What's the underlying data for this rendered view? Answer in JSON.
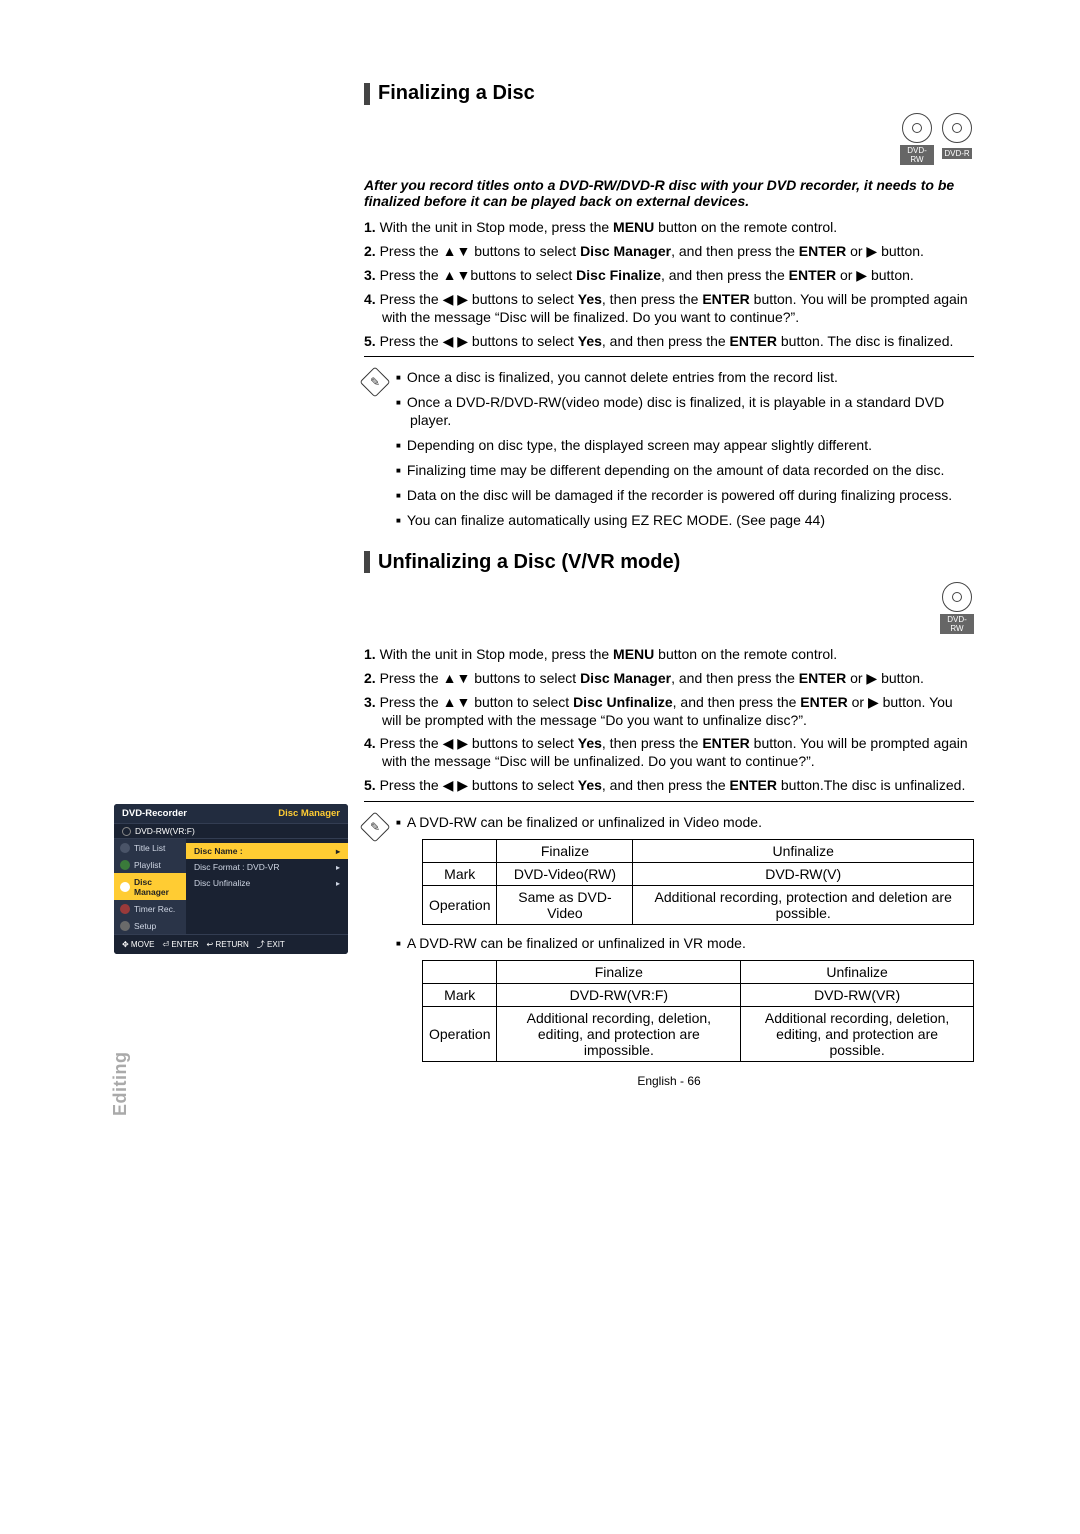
{
  "sidebar_label": "Editing",
  "sections": {
    "finalize": {
      "title": "Finalizing a Disc",
      "disc_icons": [
        "DVD-RW",
        "DVD-R"
      ],
      "intro": "After you record titles onto a DVD-RW/DVD-R disc with your DVD recorder, it needs to be finalized before it can be played back on external devices.",
      "steps": [
        {
          "num": "1.",
          "parts": [
            "With the unit in Stop mode, press the ",
            "MENU",
            " button on the remote control."
          ]
        },
        {
          "num": "2.",
          "parts": [
            "Press the ▲▼ buttons to select ",
            "Disc Manager",
            ", and then press the ",
            "ENTER",
            " or ▶ button."
          ]
        },
        {
          "num": "3.",
          "parts": [
            "Press the ▲▼buttons to select ",
            "Disc Finalize",
            ", and then press the ",
            "ENTER",
            " or ▶ button."
          ]
        },
        {
          "num": "4.",
          "parts": [
            "Press the ◀ ▶ buttons to select ",
            "Yes",
            ", then press the ",
            "ENTER",
            " button. You will be prompted again with the message “Disc will be finalized. Do you want to continue?”."
          ]
        },
        {
          "num": "5.",
          "parts": [
            "Press the ◀ ▶ buttons to select ",
            "Yes",
            ", and then press the ",
            "ENTER",
            " button. The disc is finalized."
          ]
        }
      ],
      "notes": [
        "Once a disc is finalized, you cannot delete entries from the record list.",
        "Once a DVD-R/DVD-RW(video mode) disc is finalized, it is playable in a standard DVD player.",
        "Depending on disc type, the displayed screen may appear slightly different.",
        "Finalizing time may be different depending on the amount of data recorded on the disc.",
        "Data on the disc will be damaged if the recorder is powered off during finalizing process.",
        "You can finalize automatically using EZ REC MODE. (See page 44)"
      ]
    },
    "unfinalize": {
      "title": "Unfinalizing a Disc (V/VR mode)",
      "disc_icons": [
        "DVD-RW"
      ],
      "steps": [
        {
          "num": "1.",
          "parts": [
            "With the unit in Stop mode, press the ",
            "MENU",
            " button on the remote control."
          ]
        },
        {
          "num": "2.",
          "parts": [
            "Press the ▲▼ buttons to select ",
            "Disc Manager",
            ", and then press the ",
            "ENTER",
            " or ▶ button."
          ]
        },
        {
          "num": "3.",
          "parts": [
            "Press the ▲▼ button to select ",
            "Disc Unfinalize",
            ", and then press the ",
            "ENTER",
            " or ▶ button. You will be prompted with the message “Do you want to unfinalize disc?”."
          ]
        },
        {
          "num": "4.",
          "parts": [
            "Press the ◀ ▶ buttons to select ",
            "Yes",
            ", then press the ",
            "ENTER",
            " button. You will be prompted again with the message “Disc will be unfinalized. Do you want to continue?”."
          ]
        },
        {
          "num": "5.",
          "parts": [
            "Press the ◀ ▶ buttons to select ",
            "Yes",
            ", and then press the ",
            "ENTER",
            " button.The disc is unfinalized."
          ]
        }
      ],
      "note_intro_video": "A DVD-RW can be finalized or unfinalized in Video mode.",
      "table_video": {
        "headers": [
          "",
          "Finalize",
          "Unfinalize"
        ],
        "rows": [
          [
            "Mark",
            "DVD-Video(RW)",
            "DVD-RW(V)"
          ],
          [
            "Operation",
            "Same as DVD-Video",
            "Additional recording, protection and deletion are possible."
          ]
        ]
      },
      "note_intro_vr": "A DVD-RW can be finalized or unfinalized in VR mode.",
      "table_vr": {
        "headers": [
          "",
          "Finalize",
          "Unfinalize"
        ],
        "rows": [
          [
            "Mark",
            "DVD-RW(VR:F)",
            "DVD-RW(VR)"
          ],
          [
            "Operation",
            "Additional recording, deletion, editing, and protection are impossible.",
            "Additional recording, deletion, editing, and protection are possible."
          ]
        ]
      }
    }
  },
  "osd": {
    "title_left": "DVD-Recorder",
    "title_right": "Disc Manager",
    "subtitle": "DVD-RW(VR:F)",
    "nav": [
      {
        "label": "Title List",
        "cls": ""
      },
      {
        "label": "Playlist",
        "cls": "green"
      },
      {
        "label": "Disc Manager",
        "cls": "blue selected"
      },
      {
        "label": "Timer Rec.",
        "cls": "red"
      },
      {
        "label": "Setup",
        "cls": "gray"
      }
    ],
    "options": [
      {
        "label": "Disc Name  :",
        "selected": true
      },
      {
        "label": "Disc Format  : DVD-VR",
        "selected": false
      },
      {
        "label": "Disc Unfinalize",
        "selected": false
      }
    ],
    "footer": [
      "✥ MOVE",
      "⏎ ENTER",
      "↩ RETURN",
      "⤴ EXIT"
    ]
  },
  "footer": "English - 66"
}
